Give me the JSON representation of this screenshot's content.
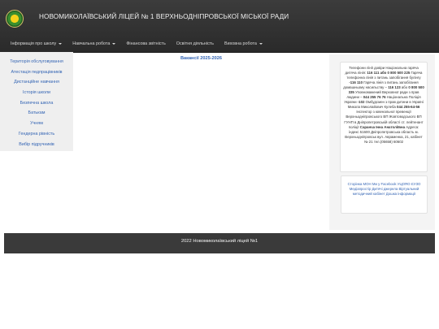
{
  "header": {
    "title": "НОВОМИКОЛАЇВСЬКИЙ ЛІЦЕЙ № 1 ВЕРХНЬОДНІПРОВСЬКОЇ МІСЬКОЇ РАДИ",
    "logo_icon": "school-emblem-logo",
    "nav": [
      {
        "label": "Інформація про школу",
        "has_dropdown": true
      },
      {
        "label": "Навчальна робота",
        "has_dropdown": true
      },
      {
        "label": "Фінансова звітність",
        "has_dropdown": false
      },
      {
        "label": "Освітня діяльність",
        "has_dropdown": false
      },
      {
        "label": "Виховна робота",
        "has_dropdown": true
      }
    ]
  },
  "sidebar": {
    "items": [
      {
        "label": "Територія обслуговування"
      },
      {
        "label": "Атестація педпрацівників"
      },
      {
        "label": "Дистанційне навчання"
      },
      {
        "label": "Історія школи"
      },
      {
        "label": "Безпечна школа"
      },
      {
        "label": "Батькам"
      },
      {
        "label": "Учням"
      },
      {
        "label": "Гендерна рівність"
      },
      {
        "label": "Вибір підручників"
      }
    ]
  },
  "main": {
    "heading": "Вакансії 2025-2026"
  },
  "right_panel": {
    "info": {
      "t1": "Телефони лінії довіри Національна гаряча дитяча лінія:",
      "b1": "116 111 або 0 800 500 225",
      "t2": "Гаряча телефонна лінія з питань запобігання булінгу",
      "b2": "-116 110",
      "t3": "Гаряча лінія з питань запобігання домашньому насильству –",
      "b3": "116 123",
      "t4": "або",
      "b4": "0 800 500 335",
      "t5": "Уповноважений Верховної ради з прав людини –",
      "b5": "044 255 76 76",
      "t6": "Національна Поліція України",
      "b6": "-102",
      "t7": "Омбудсмен з прав дитини в Україні Микола Миколайович Кулеба",
      "b7": "044 255-64-56",
      "t8": "Інспектор з ювенальної превенції Верхньодніпровського ВП Жовтоводського ВП ГУНП в Дніпропетровській області ст. лейтенант поліції",
      "b8": "Саранча Інна Анатоліївна",
      "t9": "Адреса: індекс 51600 Дніпропетровська область м. Верхньодніпровськ вул. Авраменка, 21, кабінет № 21 тел.(05658) 60602"
    },
    "links": [
      {
        "label": "Сторінка МОН"
      },
      {
        "label": "Ми у Facebook"
      },
      {
        "label": "УЦОЯО"
      },
      {
        "label": "ЄУЗО"
      },
      {
        "label": "Медіапростір"
      },
      {
        "label": "Дитячі джерела"
      },
      {
        "label": "Віртуальний методичний кабінет"
      },
      {
        "label": "Дошка інформації"
      }
    ]
  },
  "footer": {
    "text": "2022 Новомиколаївський ліцей №1"
  }
}
